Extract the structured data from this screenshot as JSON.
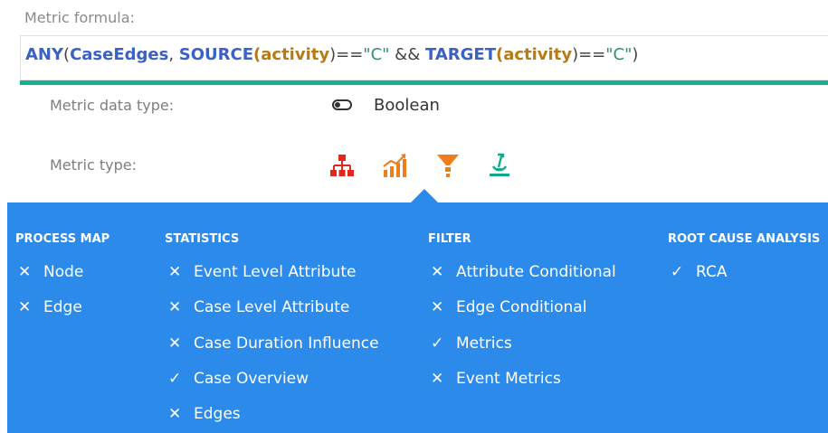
{
  "formula": {
    "label": "Metric formula:",
    "tokens": {
      "fn_any": "ANY",
      "p1": "(",
      "case_edges": "CaseEdges",
      "comma": ", ",
      "fn_source": "SOURCE",
      "p2": "(",
      "arg1": "activity",
      "p3": ")==",
      "str1": "\"C\"",
      "and": " && ",
      "fn_target": "TARGET",
      "p4": "(",
      "arg2": "activity",
      "p5": ")==",
      "str2": "\"C\"",
      "p6": ")"
    },
    "underline_color": "#12b08f"
  },
  "data_type": {
    "label": "Metric data type:",
    "icon": "toggle-icon",
    "value": "Boolean"
  },
  "metric_type": {
    "label": "Metric type:",
    "icons": [
      {
        "name": "process-map-icon",
        "color": "#e0281c"
      },
      {
        "name": "statistics-icon",
        "color": "#f07d1c"
      },
      {
        "name": "filter-icon",
        "color": "#f07d1c",
        "selected": true
      },
      {
        "name": "root-cause-icon",
        "color": "#12a88a"
      }
    ]
  },
  "panel": {
    "background": "#2c8bea",
    "columns": [
      {
        "heading": "PROCESS MAP",
        "items": [
          {
            "mark": "✕",
            "label": "Node"
          },
          {
            "mark": "✕",
            "label": "Edge"
          }
        ]
      },
      {
        "heading": "STATISTICS",
        "items": [
          {
            "mark": "✕",
            "label": "Event Level Attribute"
          },
          {
            "mark": "✕",
            "label": "Case Level Attribute"
          },
          {
            "mark": "✕",
            "label": "Case Duration Influence"
          },
          {
            "mark": "✓",
            "label": "Case Overview"
          },
          {
            "mark": "✕",
            "label": "Edges"
          }
        ]
      },
      {
        "heading": "FILTER",
        "items": [
          {
            "mark": "✕",
            "label": "Attribute Conditional"
          },
          {
            "mark": "✕",
            "label": "Edge Conditional"
          },
          {
            "mark": "✓",
            "label": "Metrics"
          },
          {
            "mark": "✕",
            "label": "Event Metrics"
          }
        ]
      },
      {
        "heading": "ROOT CAUSE ANALYSIS",
        "items": [
          {
            "mark": "✓",
            "label": "RCA"
          }
        ]
      }
    ]
  }
}
